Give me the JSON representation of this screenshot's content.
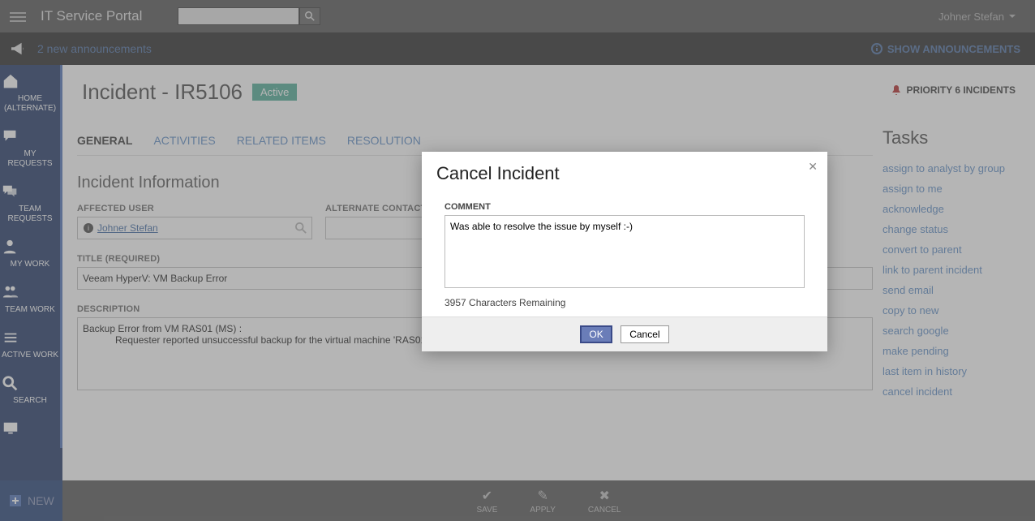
{
  "header": {
    "portal_title": "IT Service Portal",
    "user_name": "Johner Stefan"
  },
  "announce": {
    "text": "2 new announcements",
    "show": "SHOW ANNOUNCEMENTS"
  },
  "sidebar": {
    "items": [
      {
        "label": "HOME (ALTERNATE)",
        "icon": "home"
      },
      {
        "label": "MY REQUESTS",
        "icon": "comment"
      },
      {
        "label": "TEAM REQUESTS",
        "icon": "comments"
      },
      {
        "label": "MY WORK",
        "icon": "user"
      },
      {
        "label": "TEAM WORK",
        "icon": "users"
      },
      {
        "label": "ACTIVE WORK",
        "icon": "list"
      },
      {
        "label": "SEARCH",
        "icon": "search"
      }
    ],
    "new_label": "NEW"
  },
  "page": {
    "title": "Incident - IR5106",
    "status": "Active",
    "priority": "PRIORITY 6 INCIDENTS"
  },
  "tabs": [
    "GENERAL",
    "ACTIVITIES",
    "RELATED ITEMS",
    "RESOLUTION"
  ],
  "form": {
    "section": "Incident Information",
    "affected_label": "AFFECTED USER",
    "affected_value": "Johner Stefan",
    "alternate_label": "ALTERNATE CONTACT",
    "alternate_value": "",
    "title_label": "TITLE (REQUIRED)",
    "title_value": "Veeam HyperV: VM Backup Error",
    "desc_label": "DESCRIPTION",
    "desc_value": "Backup Error from VM RAS01 (MS) :\n            Requester reported unsuccessful backup for the virtual machine 'RAS01'"
  },
  "tasks": {
    "title": "Tasks",
    "items": [
      "assign to analyst by group",
      "assign to me",
      "acknowledge",
      "change status",
      "convert to parent",
      "link to parent incident",
      "send email",
      "copy to new",
      "search google",
      "make pending",
      "last item in history",
      "cancel incident"
    ]
  },
  "footer": {
    "save": "SAVE",
    "apply": "APPLY",
    "cancel": "CANCEL"
  },
  "modal": {
    "title": "Cancel Incident",
    "comment_label": "COMMENT",
    "comment_value": "Was able to resolve the issue by myself :-)",
    "remaining": "3957 Characters Remaining",
    "ok": "OK",
    "cancel": "Cancel"
  }
}
